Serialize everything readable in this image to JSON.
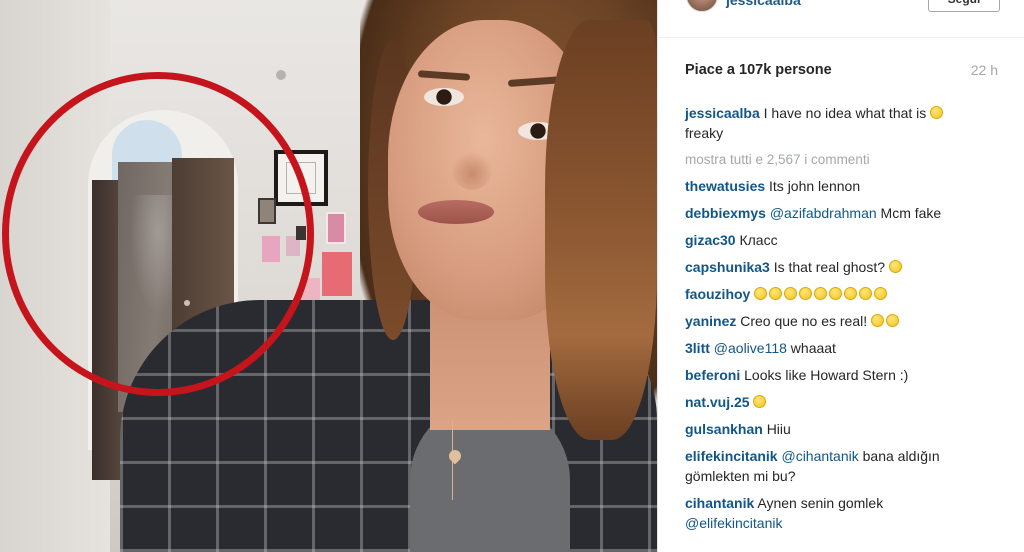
{
  "post": {
    "username": "jessicaalba",
    "follow_label": "Segui",
    "likes": "Piace a 107k persone",
    "time": "22 h",
    "show_all_comments": "mostra tutti e 2,567 i commenti"
  },
  "comments": [
    {
      "user": "jessicaalba",
      "text": "I have no idea what that is",
      "emojis": 1,
      "tail": "freaky"
    },
    {
      "user": "thewatusies",
      "text": "Its john lennon"
    },
    {
      "user": "debbiexmys",
      "text": "Mcm fake",
      "mention": "@azifabdrahman"
    },
    {
      "user": "gizac30",
      "text": "Класс"
    },
    {
      "user": "capshunika3",
      "text": "Is that real ghost?",
      "emojis": 1
    },
    {
      "user": "faouzihoy",
      "text": "",
      "emojis": 9
    },
    {
      "user": "yaninez",
      "text": "Creo que no es real!",
      "emojis": 2
    },
    {
      "user": "3litt",
      "mention": "@aolive118",
      "text": "whaaat"
    },
    {
      "user": "beferoni",
      "text": "Looks like Howard Stern :)"
    },
    {
      "user": "nat.vuj.25",
      "text": "",
      "emojis": 1
    },
    {
      "user": "gulsankhan",
      "text": "Hiiu"
    },
    {
      "user": "elifekincitanik",
      "mention": "@cihantanik",
      "text": "bana aldığın gömlekten mi bu?"
    },
    {
      "user": "cihantanik",
      "text": "Aynen senin gomlek",
      "mention_after": "@elifekincitanik"
    }
  ],
  "colors": {
    "username": "#125688",
    "highlight_circle": "#c5141c",
    "muted": "#a5a7aa"
  }
}
